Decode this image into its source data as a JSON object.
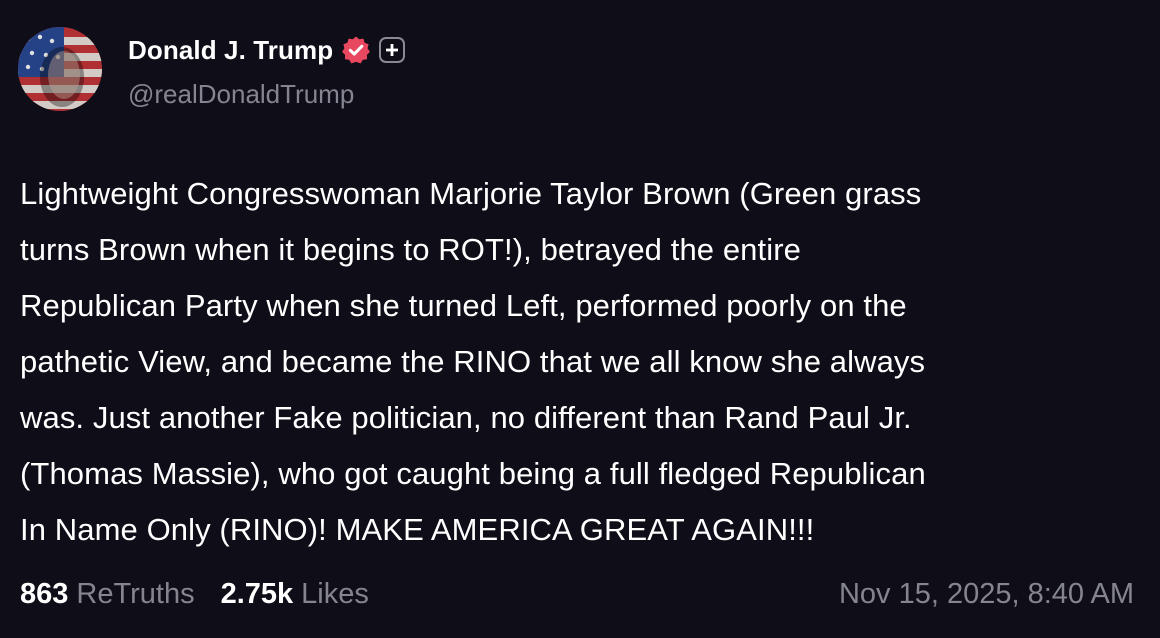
{
  "author": {
    "display_name": "Donald J. Trump",
    "handle": "@realDonaldTrump",
    "avatar_icon": "flag-portrait-avatar",
    "verified_icon": "verified-badge-icon",
    "verified_color": "#e8485f",
    "plus_icon": "plus-badge-icon"
  },
  "post": {
    "lines": [
      "Lightweight Congresswoman Marjorie Taylor Brown (Green grass",
      "turns Brown when it begins to ROT!), betrayed the entire",
      "Republican Party when she turned Left, performed poorly on the",
      "pathetic View, and became the RINO that we all know she always",
      "was. Just another Fake politician, no different than Rand Paul Jr.",
      "(Thomas Massie), who got caught being a full fledged Republican",
      "In Name Only (RINO)! MAKE AMERICA GREAT AGAIN!!!"
    ]
  },
  "stats": {
    "retruths_count": "863",
    "retruths_label": "ReTruths",
    "likes_count": "2.75k",
    "likes_label": "Likes",
    "timestamp": "Nov 15, 2025, 8:40 AM"
  },
  "colors": {
    "background": "#0e0d18",
    "text_primary": "#ffffff",
    "text_secondary": "#85858f"
  }
}
